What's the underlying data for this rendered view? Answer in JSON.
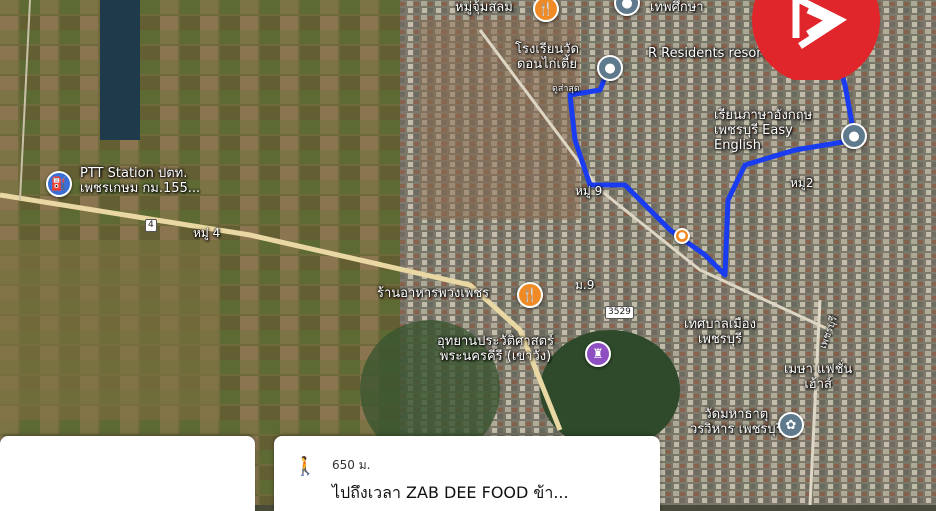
{
  "places": {
    "market": "หมู่จุ้มสลม",
    "school": "โรงเรียนวัด\nดอนไก่เตี้ย",
    "school_sub": "ดูส่าสุด",
    "municipal_top": "เทพศึกษา",
    "resort": "R Residents resort",
    "english": "เรียนภาษาอังกฤษ\nเพชรบุรี Easy\nEnglish",
    "ptt": "PTT Station ปตท.\nเพชรเกษม กม.155...",
    "moo4": "หมู่ 4",
    "moo9a": "หมู่ 9",
    "moo9b": "ม.9",
    "moo2": "หมู่2",
    "restaurant": "ร้านอาหารพวงเพชร",
    "park": "อุทยานประวัติศาสตร์\nพระนครคีรี (เขาวัง)",
    "municipality": "เทศบาลเมือง\nเพชรบุรี",
    "fashion": "เมษา แฟชั่น\nเฮ้าส์",
    "temple": "วัดมหาธาตุ\nวรวิหาร เพชรบุรี",
    "road_right": "เพชรบุรี",
    "road_num_4": "4",
    "road_num_3529": "3529"
  },
  "route_card": {
    "distance": "650 ม.",
    "destination": "ไปถึงเวลา ZAB DEE FOOD ข้า..."
  },
  "colors": {
    "route": "#1a3cf0",
    "badge": "#e0262a",
    "pin_orange": "#f08a24",
    "pin_gray": "#5f7a8c",
    "pin_blue": "#3a6fd8",
    "pin_purple": "#8e4fc2"
  },
  "icons": {
    "badge": "brand-logo-icon",
    "card": "walking-route-icon"
  }
}
